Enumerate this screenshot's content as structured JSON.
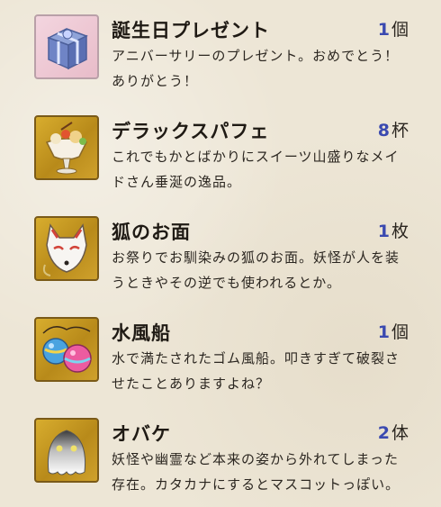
{
  "items": [
    {
      "name": "誕生日プレゼント",
      "count": "1",
      "unit": "個",
      "desc": "アニバーサリーのプレゼント。おめでとう！ありがとう！",
      "icon": "gift-box-icon"
    },
    {
      "name": "デラックスパフェ",
      "count": "8",
      "unit": "杯",
      "desc": "これでもかとばかりにスイーツ山盛りなメイドさん垂涎の逸品。",
      "icon": "parfait-icon"
    },
    {
      "name": "狐のお面",
      "count": "1",
      "unit": "枚",
      "desc": "お祭りでお馴染みの狐のお面。妖怪が人を装うときやその逆でも使われるとか。",
      "icon": "fox-mask-icon"
    },
    {
      "name": "水風船",
      "count": "1",
      "unit": "個",
      "desc": "水で満たされたゴム風船。叩きすぎて破裂させたことありますよね？",
      "icon": "water-balloon-icon"
    },
    {
      "name": "オバケ",
      "count": "2",
      "unit": "体",
      "desc": "妖怪や幽霊など本来の姿から外れてしまった存在。カタカナにするとマスコットっぽい。",
      "icon": "ghost-icon"
    }
  ]
}
